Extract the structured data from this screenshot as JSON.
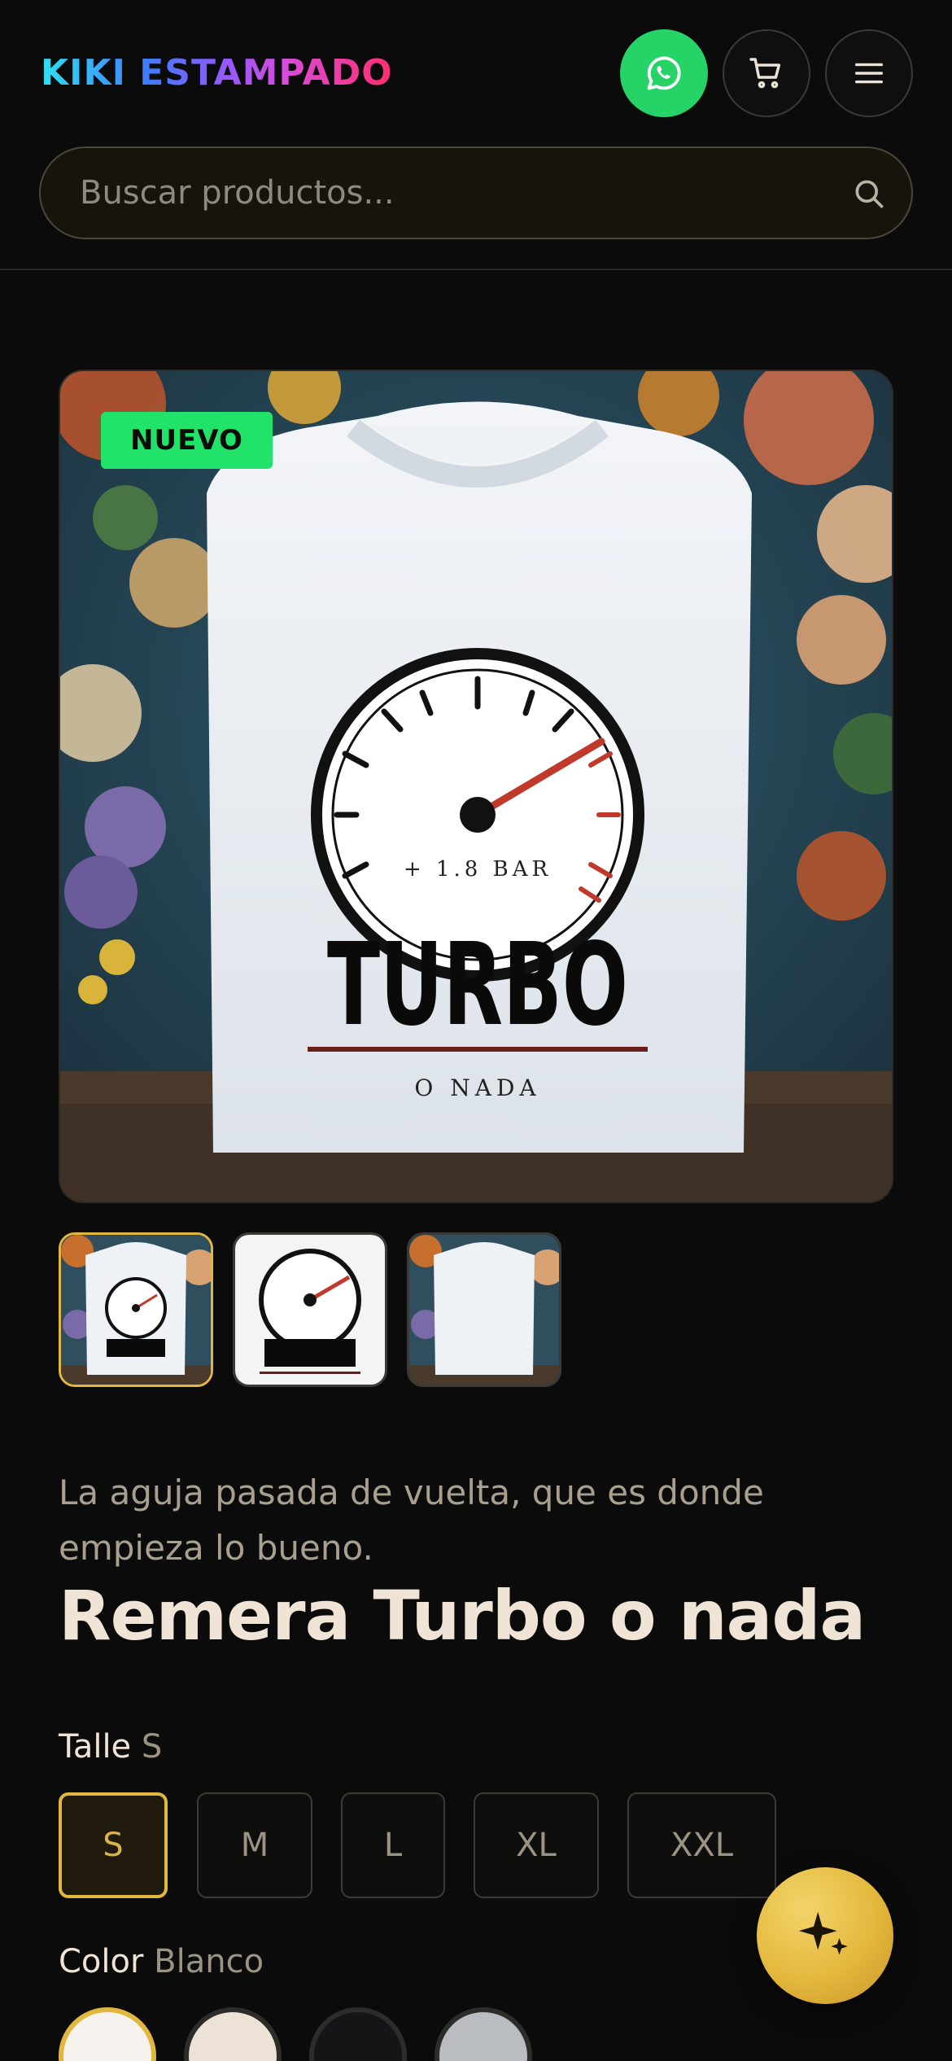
{
  "brand": {
    "logo": "KIKI ESTAMPADO"
  },
  "header": {
    "whatsapp_icon": "whatsapp-icon",
    "cart_icon": "cart-icon",
    "menu_icon": "hamburger-menu-icon"
  },
  "search": {
    "placeholder": "Buscar productos...",
    "value": "",
    "icon": "search-icon"
  },
  "product": {
    "badge": "NUEVO",
    "print_gauge_text": "+ 1.8 BAR",
    "print_main_text": "TURBO",
    "print_sub_text": "O NADA",
    "thumb_count": 3,
    "active_thumb": 0,
    "tagline": "La aguja pasada de vuelta, que es donde empieza lo bueno.",
    "title": "Remera Turbo o nada"
  },
  "size": {
    "label": "Talle",
    "selected": "S",
    "options": [
      "S",
      "M",
      "L",
      "XL",
      "XXL"
    ]
  },
  "color": {
    "label": "Color",
    "selected": "Blanco",
    "swatches": [
      "#f6f3ee",
      "#ece3d6",
      "#151517",
      "#b9bcc1"
    ]
  },
  "fab": {
    "icon": "sparkle-icon"
  },
  "colors": {
    "accent": "#e1b740",
    "whatsapp": "#25d366",
    "badge": "#22e36a"
  }
}
